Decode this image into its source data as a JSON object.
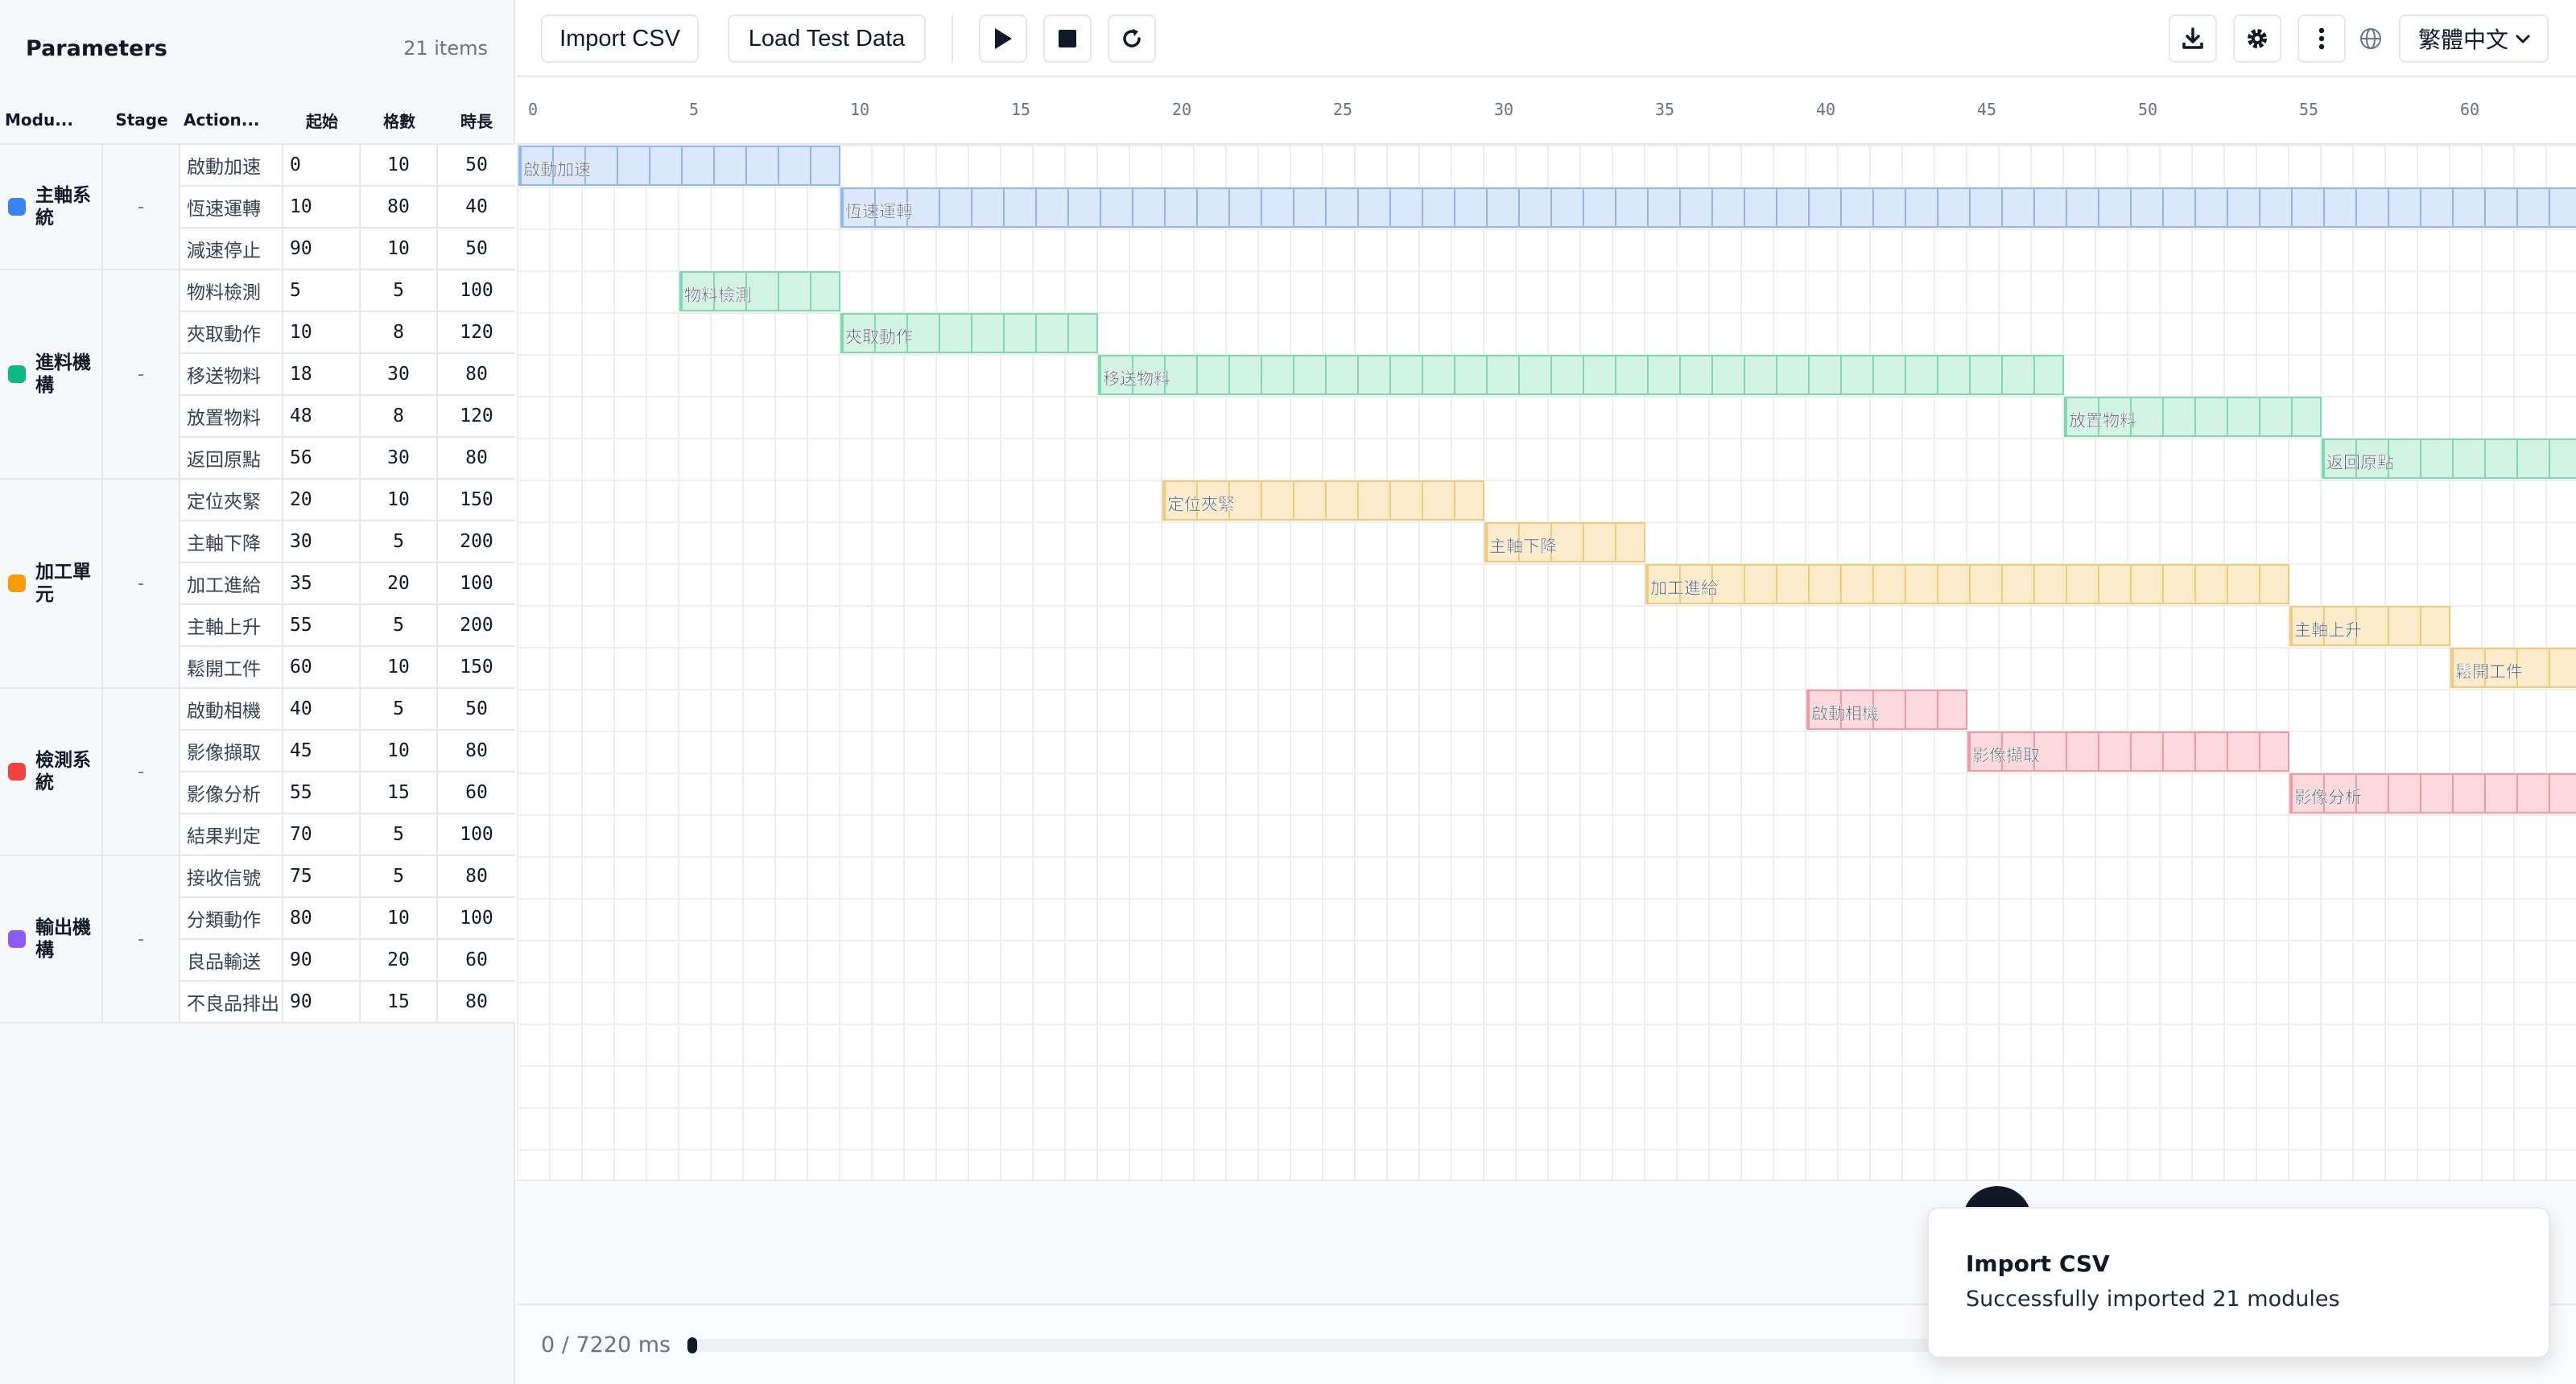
{
  "sidebar": {
    "title": "Parameters",
    "count": "21 items",
    "headers": {
      "module": "Modu...",
      "stage": "Stage",
      "action": "Action...",
      "start": "起始",
      "steps": "格數",
      "duration": "時長"
    }
  },
  "modules": [
    {
      "name": "主軸系統",
      "stage": "-",
      "color": "#3b82f6",
      "bar_bg": "#dbe8fe",
      "bar_border": "#93b7f5",
      "actions": [
        {
          "name": "啟動加速",
          "start": 0,
          "steps": 10,
          "duration": 50
        },
        {
          "name": "恆速運轉",
          "start": 10,
          "steps": 80,
          "duration": 40
        },
        {
          "name": "減速停止",
          "start": 90,
          "steps": 10,
          "duration": 50
        }
      ]
    },
    {
      "name": "進料機構",
      "stage": "-",
      "color": "#10b981",
      "bar_bg": "#d3f3e5",
      "bar_border": "#7fd8b2",
      "actions": [
        {
          "name": "物料檢測",
          "start": 5,
          "steps": 5,
          "duration": 100
        },
        {
          "name": "夾取動作",
          "start": 10,
          "steps": 8,
          "duration": 120
        },
        {
          "name": "移送物料",
          "start": 18,
          "steps": 30,
          "duration": 80
        },
        {
          "name": "放置物料",
          "start": 48,
          "steps": 8,
          "duration": 120
        },
        {
          "name": "返回原點",
          "start": 56,
          "steps": 30,
          "duration": 80
        }
      ]
    },
    {
      "name": "加工單元",
      "stage": "-",
      "color": "#f59e0b",
      "bar_bg": "#fdeccb",
      "bar_border": "#f5c97a",
      "actions": [
        {
          "name": "定位夾緊",
          "start": 20,
          "steps": 10,
          "duration": 150
        },
        {
          "name": "主軸下降",
          "start": 30,
          "steps": 5,
          "duration": 200
        },
        {
          "name": "加工進給",
          "start": 35,
          "steps": 20,
          "duration": 100
        },
        {
          "name": "主軸上升",
          "start": 55,
          "steps": 5,
          "duration": 200
        },
        {
          "name": "鬆開工件",
          "start": 60,
          "steps": 10,
          "duration": 150
        }
      ]
    },
    {
      "name": "檢測系統",
      "stage": "-",
      "color": "#ef4444",
      "bar_bg": "#fcd9dc",
      "bar_border": "#f29aa2",
      "actions": [
        {
          "name": "啟動相機",
          "start": 40,
          "steps": 5,
          "duration": 50
        },
        {
          "name": "影像擷取",
          "start": 45,
          "steps": 10,
          "duration": 80
        },
        {
          "name": "影像分析",
          "start": 55,
          "steps": 15,
          "duration": 60
        },
        {
          "name": "結果判定",
          "start": 70,
          "steps": 5,
          "duration": 100
        }
      ]
    },
    {
      "name": "輸出機構",
      "stage": "-",
      "color": "#8b5cf6",
      "bar_bg": "#ebe2fd",
      "bar_border": "#c4b0f6",
      "actions": [
        {
          "name": "接收信號",
          "start": 75,
          "steps": 5,
          "duration": 80
        },
        {
          "name": "分類動作",
          "start": 80,
          "steps": 10,
          "duration": 100
        },
        {
          "name": "良品輸送",
          "start": 90,
          "steps": 20,
          "duration": 60
        },
        {
          "name": "不良品排出",
          "start": 90,
          "steps": 15,
          "duration": 80
        }
      ]
    }
  ],
  "toolbar": {
    "import_label": "Import CSV",
    "load_test_label": "Load Test Data",
    "icons": [
      "play-icon",
      "stop-icon",
      "reload-icon",
      "download-icon",
      "gear-icon",
      "more-vertical-icon",
      "globe-icon"
    ],
    "language": "繁體中文"
  },
  "timeline": {
    "ticks": [
      0,
      5,
      10,
      15,
      20,
      25,
      30,
      35,
      40,
      45,
      50,
      55,
      60
    ]
  },
  "playback": {
    "time": "0 / 7220 ms",
    "progress": 0
  },
  "toast": {
    "title": "Import CSV",
    "message": "Successfully imported 21 modules"
  }
}
